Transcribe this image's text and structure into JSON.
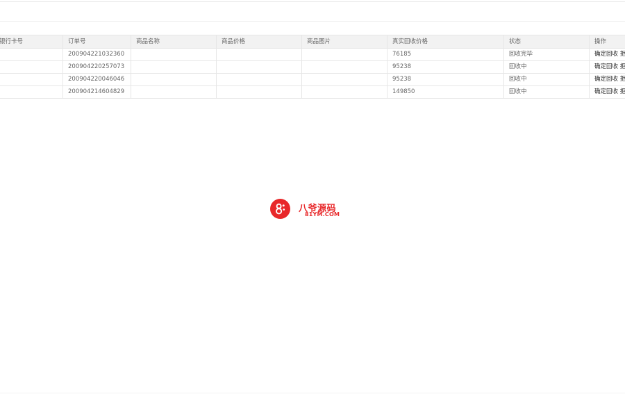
{
  "table": {
    "headers": [
      "银行卡号",
      "订单号",
      "商品名称",
      "商品价格",
      "商品图片",
      "真实回收价格",
      "状态",
      "操作"
    ],
    "rows": [
      {
        "bank_card": "",
        "order_no": "200904221032360",
        "product_name": "",
        "product_price": "",
        "product_image": "",
        "real_price": "76185",
        "status": "回收完毕",
        "action": "确定回收 拒"
      },
      {
        "bank_card": "",
        "order_no": "200904220257073",
        "product_name": "",
        "product_price": "",
        "product_image": "",
        "real_price": "95238",
        "status": "回收中",
        "action": "确定回收 拒"
      },
      {
        "bank_card": "",
        "order_no": "200904220046046",
        "product_name": "",
        "product_price": "",
        "product_image": "",
        "real_price": "95238",
        "status": "回收中",
        "action": "确定回收 拒"
      },
      {
        "bank_card": "",
        "order_no": "200904214604829",
        "product_name": "",
        "product_price": "",
        "product_image": "",
        "real_price": "149850",
        "status": "回收中",
        "action": "确定回收 拒"
      }
    ]
  },
  "watermark": {
    "title": "八爷源码",
    "subtitle": "81YM.COM",
    "icon": "81ym-logo-icon",
    "color": "#e8282a"
  }
}
